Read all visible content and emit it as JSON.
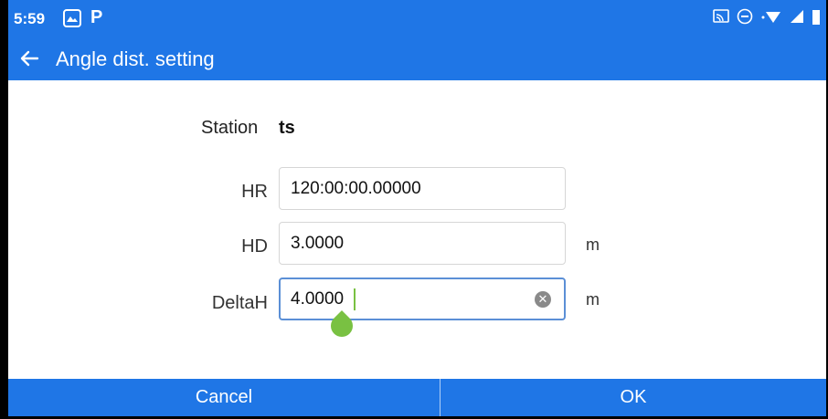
{
  "status_bar": {
    "time": "5:59",
    "icons": [
      "gallery-icon",
      "parking-app-icon",
      "cast-icon",
      "do-not-disturb-icon",
      "wifi-icon",
      "signal-icon",
      "battery-icon"
    ]
  },
  "app_bar": {
    "title": "Angle dist. setting",
    "back_icon": "arrow-left-icon"
  },
  "form": {
    "station_label": "Station",
    "station_value": "ts",
    "fields": [
      {
        "label": "HR",
        "value": "120:00:00.00000",
        "unit": ""
      },
      {
        "label": "HD",
        "value": "3.0000",
        "unit": "m"
      },
      {
        "label": "DeltaH",
        "value": "4.0000",
        "unit": "m",
        "focused": true
      }
    ]
  },
  "buttons": {
    "cancel": "Cancel",
    "ok": "OK"
  },
  "colors": {
    "primary": "#1f76e6",
    "focus_border": "#5b8fd6",
    "cursor": "#79c142"
  }
}
